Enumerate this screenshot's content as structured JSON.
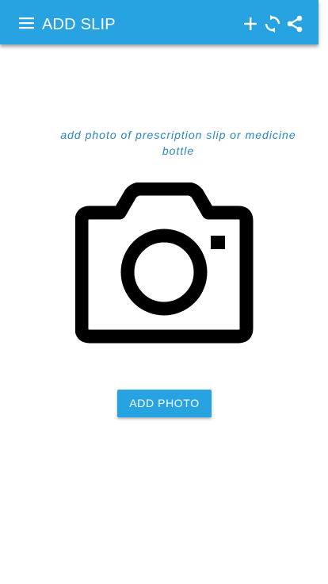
{
  "appbar": {
    "title": "ADD SLIP",
    "icons": {
      "menu": "menu-icon",
      "add": "plus-icon",
      "refresh": "refresh-icon",
      "share": "share-icon"
    },
    "color": "#26a3e0"
  },
  "content": {
    "hint": "add photo of prescription slip or medicine bottle",
    "illustration": "camera-icon",
    "button_label": "ADD PHOTO"
  },
  "colors": {
    "accent": "#26a3e0",
    "hint_text": "#2a86c0",
    "icon": "#000000"
  }
}
